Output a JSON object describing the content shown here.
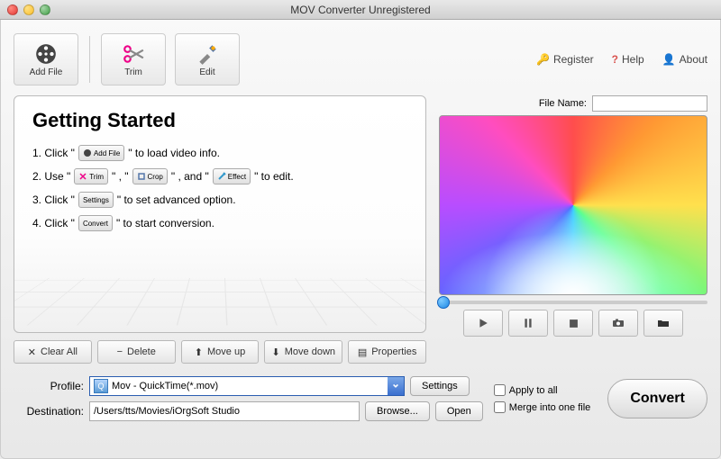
{
  "window": {
    "title": "MOV Converter Unregistered"
  },
  "toolbar": {
    "add_file": "Add File",
    "trim": "Trim",
    "edit": "Edit"
  },
  "header_links": {
    "register": "Register",
    "help": "Help",
    "about": "About"
  },
  "getting_started": {
    "title": "Getting Started",
    "step1_prefix": "1. Click \"",
    "step1_suffix": "\" to load video info.",
    "step2_prefix": "2. Use \"",
    "step2_mid1": "\" , \"",
    "step2_mid2": "\" , and \"",
    "step2_suffix": "\" to edit.",
    "step3_prefix": "3. Click \"",
    "step3_suffix": "\" to set advanced option.",
    "step4_prefix": "4. Click \"",
    "step4_suffix": "\" to start conversion.",
    "mini": {
      "add_file": "Add File",
      "trim": "Trim",
      "crop": "Crop",
      "effect": "Effect",
      "settings": "Settings",
      "convert": "Convert"
    }
  },
  "list_actions": {
    "clear_all": "Clear All",
    "delete": "Delete",
    "move_up": "Move up",
    "move_down": "Move down",
    "properties": "Properties"
  },
  "preview": {
    "file_name_label": "File Name:",
    "file_name_value": ""
  },
  "bottom": {
    "profile_label": "Profile:",
    "profile_value": "Mov - QuickTime(*.mov)",
    "settings_btn": "Settings",
    "destination_label": "Destination:",
    "destination_value": "/Users/tts/Movies/iOrgSoft Studio",
    "browse_btn": "Browse...",
    "open_btn": "Open",
    "apply_all": "Apply to all",
    "merge": "Merge into one file",
    "convert": "Convert"
  }
}
